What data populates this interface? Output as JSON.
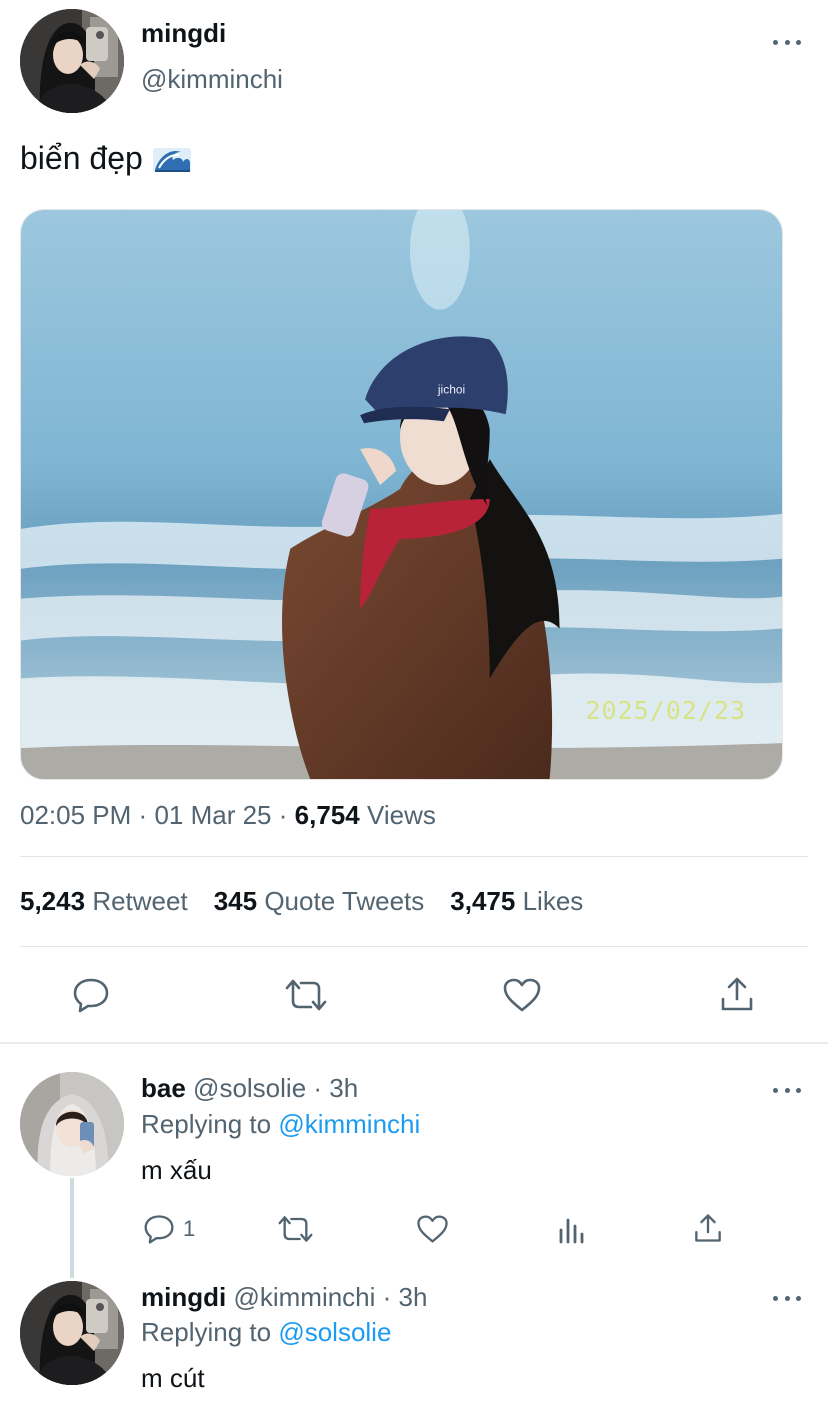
{
  "main_tweet": {
    "author_name": "mingdi",
    "author_handle": "@kimminchi",
    "text": "biển đẹp",
    "emoji_icon": "water-wave-icon",
    "photo_date_stamp": "2025/02/23",
    "time": "02:05 PM",
    "date": "01 Mar 25",
    "views_count": "6,754",
    "views_label": "Views",
    "separator": "·",
    "stats": {
      "retweets_count": "5,243",
      "retweets_label": "Retweet",
      "quotes_count": "345",
      "quotes_label": "Quote Tweets",
      "likes_count": "3,475",
      "likes_label": "Likes"
    },
    "actions": [
      "reply-icon",
      "retweet-icon",
      "like-icon",
      "share-icon"
    ]
  },
  "replies": [
    {
      "author_name": "bae",
      "author_handle": "@solsolie",
      "time_ago": "· 3h",
      "replying_prefix": "Replying to",
      "replying_to": "@kimminchi",
      "text": "m xấu",
      "reply_count": "1"
    },
    {
      "author_name": "mingdi",
      "author_handle": "@kimminchi",
      "time_ago": "· 3h",
      "replying_prefix": "Replying to",
      "replying_to": "@solsolie",
      "text": "m cút"
    }
  ],
  "colors": {
    "text": "#0f1419",
    "secondary": "#536471",
    "link": "#1d9bf0",
    "divider": "#e1e6ea"
  }
}
